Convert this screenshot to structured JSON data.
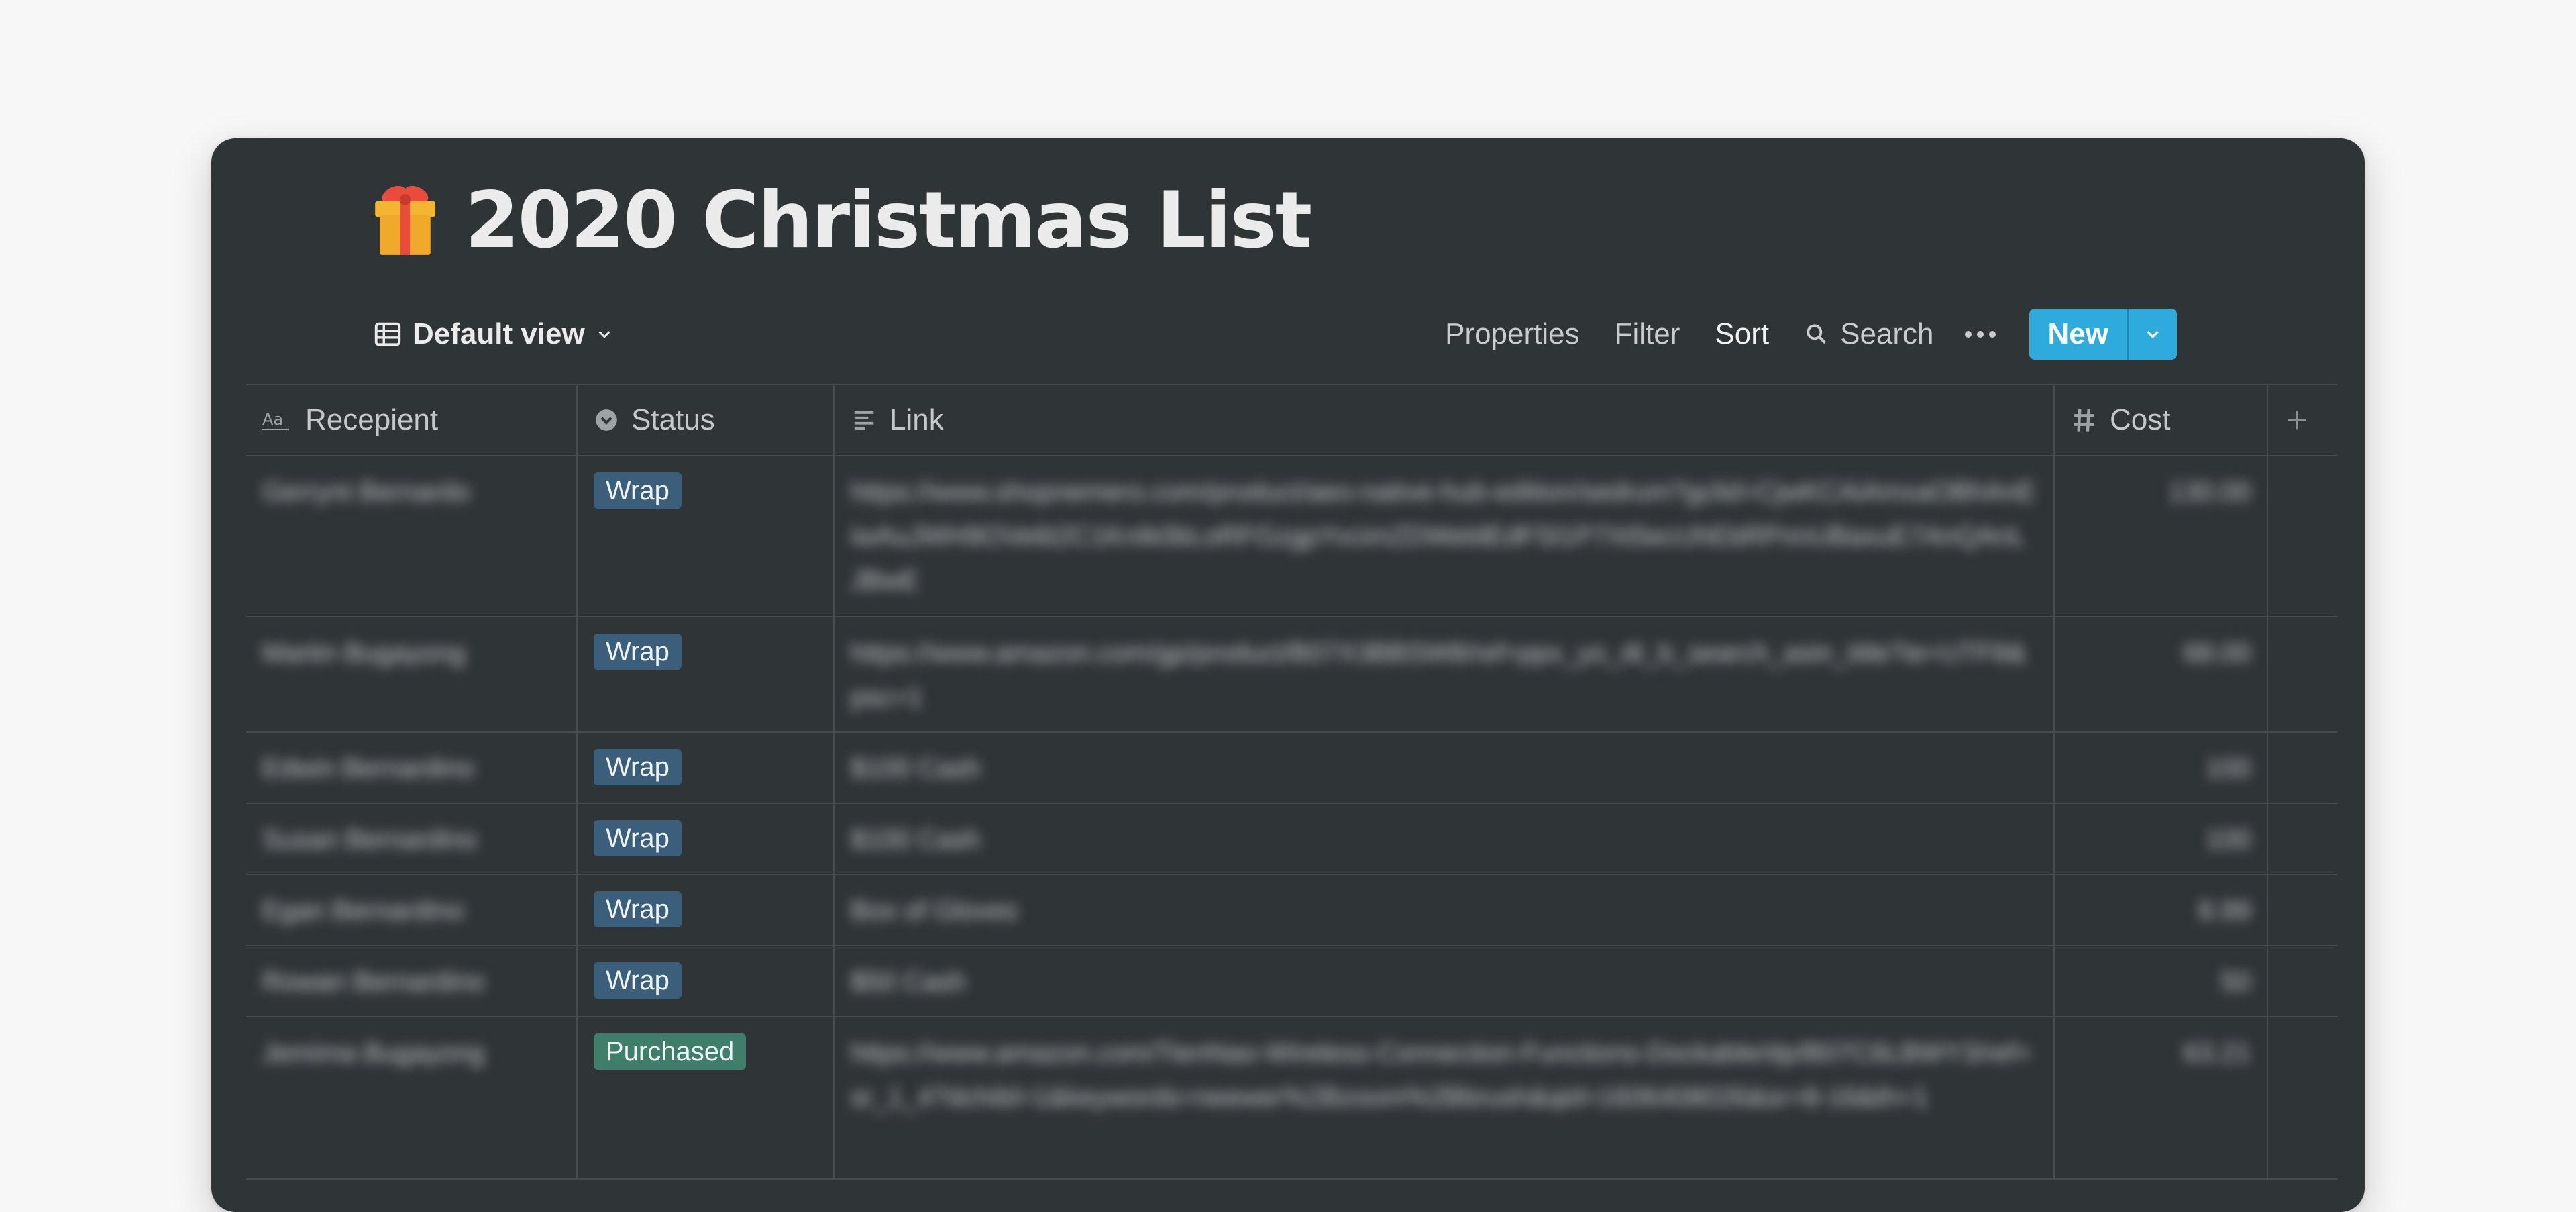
{
  "page": {
    "title": "2020 Christmas List",
    "icon": "gift-emoji-icon"
  },
  "toolbar": {
    "view_label": "Default view",
    "properties": "Properties",
    "filter": "Filter",
    "sort": "Sort",
    "search": "Search",
    "new_label": "New"
  },
  "columns": {
    "recipient": "Recepient",
    "status": "Status",
    "link": "Link",
    "cost": "Cost"
  },
  "rows": [
    {
      "name": "Gerrynt Bernardo",
      "status": "Wrap",
      "link": "https://www.shopnemero.com/product/aeo-native-hub-edition/sedrum?gclid=CjwKCAiAmxaOBhAnEiwAuJWH9OVe6t2C1KnIk0bLoRFGzgpYvcimZDWeldEdFSl1P7Xt5ecUhEbRPnnUBaxuE7AnQAnLJBwE",
      "cost": "130.00"
    },
    {
      "name": "Martin Bugayong",
      "status": "Wrap",
      "link": "https://www.amazon.com/gp/product/B07X3BBSW8/ref=ppx_yo_dt_b_search_asin_title?ie=UTF8&psc=1",
      "cost": "68.00"
    },
    {
      "name": "Edwin Bernardino",
      "status": "Wrap",
      "link": "$100 Cash",
      "cost": "100"
    },
    {
      "name": "Susan Bernardino",
      "status": "Wrap",
      "link": "$100 Cash",
      "cost": "100"
    },
    {
      "name": "Egan Bernardino",
      "status": "Wrap",
      "link": "Box of Gloves",
      "cost": "8.99"
    },
    {
      "name": "Rowan Bernardino",
      "status": "Wrap",
      "link": "$50 Cash",
      "cost": "50"
    },
    {
      "name": "Jemima Bugayong",
      "status": "Purchased",
      "link": "https://www.amazon.com/TienNao-Wireless-Connection-Functions-Dockable/dp/B07C6LBWY3/ref=sr_1_4?dchild=1&keywords=neewer%2Bzoom%2Bbrush&qid=1606408026&sr=8-16&th=1",
      "cost": "63.21"
    }
  ],
  "colors": {
    "background": "#f7f7f7",
    "window": "#2f3437",
    "accent": "#2eaadc",
    "tag_wrap": "#3b5f7a",
    "tag_purchased": "#3f7e69"
  }
}
